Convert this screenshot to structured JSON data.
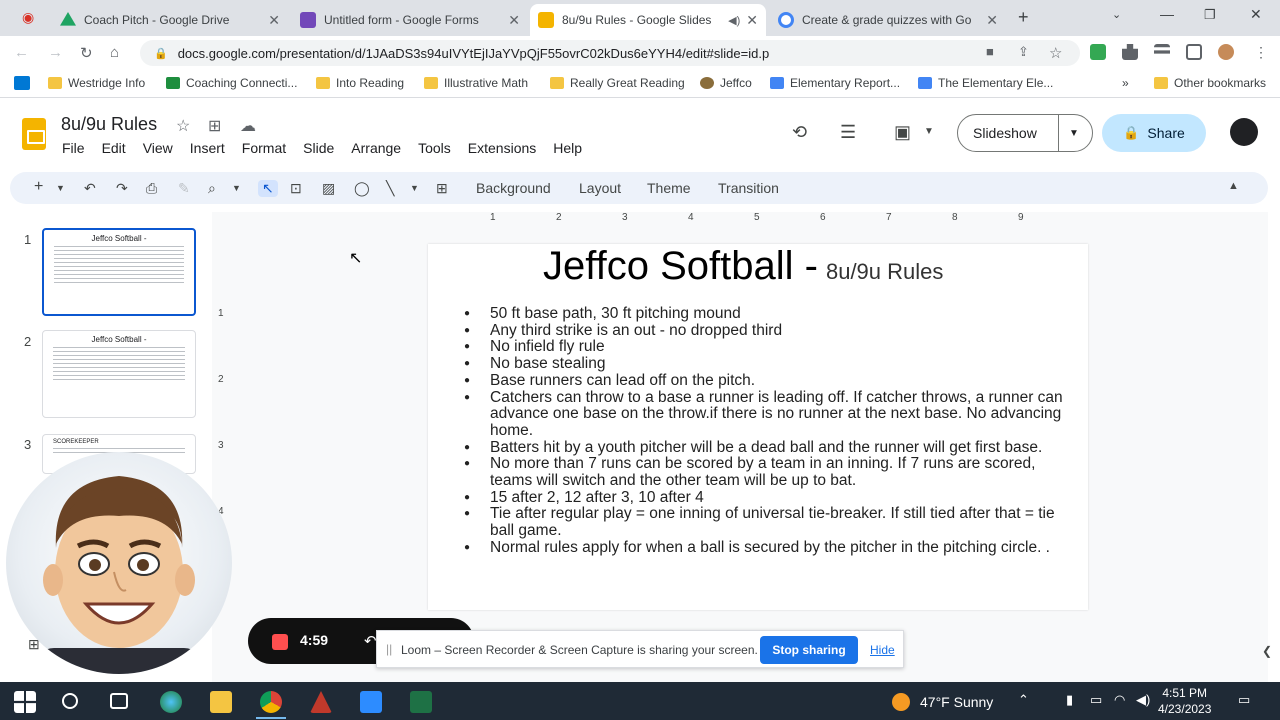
{
  "browser": {
    "tabs": [
      {
        "title": "Coach Pitch - Google Drive",
        "active": false,
        "color": "#1fa463"
      },
      {
        "title": "Untitled form - Google Forms",
        "active": false,
        "color": "#7248b9"
      },
      {
        "title": "8u/9u Rules - Google Slides",
        "active": true,
        "color": "#f4b400"
      },
      {
        "title": "Create & grade quizzes with Go",
        "active": false,
        "color": "#4285f4"
      }
    ],
    "url": "docs.google.com/presentation/d/1JAaDS3s94uIVYtEjIJaYVpQjF55ovrC02kDus6eYYH4/edit#slide=id.p",
    "bookmarks": [
      "Westridge Info",
      "Coaching Connecti...",
      "Into Reading",
      "Illustrative Math",
      "Really Great Reading",
      "Jeffco",
      "Elementary Report...",
      "The Elementary Ele...",
      "Other bookmarks"
    ],
    "more_bookmarks": "»"
  },
  "slides": {
    "doc_title": "8u/9u Rules",
    "menu": [
      "File",
      "Edit",
      "View",
      "Insert",
      "Format",
      "Slide",
      "Arrange",
      "Tools",
      "Extensions",
      "Help"
    ],
    "slideshow_label": "Slideshow",
    "share_label": "Share",
    "toolbar_text_buttons": [
      "Background",
      "Layout",
      "Theme",
      "Transition"
    ],
    "ruler_labels": [
      "1",
      "2",
      "3",
      "4",
      "5",
      "6",
      "7",
      "8",
      "9"
    ],
    "vruler_labels": [
      "1",
      "2",
      "3",
      "4"
    ],
    "thumbnails": [
      {
        "num": "1",
        "title": "Jeffco Softball -",
        "selected": true
      },
      {
        "num": "2",
        "title": "Jeffco Softball -",
        "selected": false
      },
      {
        "num": "3",
        "title": "SCOREKEEPER",
        "selected": false
      }
    ]
  },
  "slide": {
    "title": "Jeffco Softball -",
    "subtitle": "8u/9u Rules",
    "rules": [
      "50 ft base path, 30 ft pitching mound",
      "Any third strike is an out - no dropped third",
      "No infield fly rule",
      "No base stealing",
      "Base runners can lead off on the pitch.",
      "Catchers can throw to a base a runner is leading off.  If catcher throws, a runner can advance one base on the throw.if there is no runner at the next base.  No advancing home.",
      "Batters hit by a youth pitcher will be a dead ball and the runner will get first base.",
      "No more than 7 runs can be scored by a team in an inning.  If 7 runs are scored, teams will switch and the other team will be up to bat.",
      "15 after 2, 12 after 3, 10 after 4",
      "Tie after regular play = one inning of universal tie-breaker.  If still tied after that = tie ball game.",
      "Normal rules apply for when a ball is secured by the pitcher in the pitching circle. ."
    ]
  },
  "loom": {
    "timer": "4:59",
    "message": "Loom – Screen Recorder & Screen Capture is sharing your screen.",
    "stop_label": "Stop sharing",
    "hide_label": "Hide"
  },
  "taskbar": {
    "weather": "47°F  Sunny",
    "time": "4:51 PM",
    "date": "4/23/2023"
  },
  "colors": {
    "accent_blue": "#0b57d0",
    "share_bg": "#c2e7ff",
    "loom_button": "#1a73e8"
  }
}
